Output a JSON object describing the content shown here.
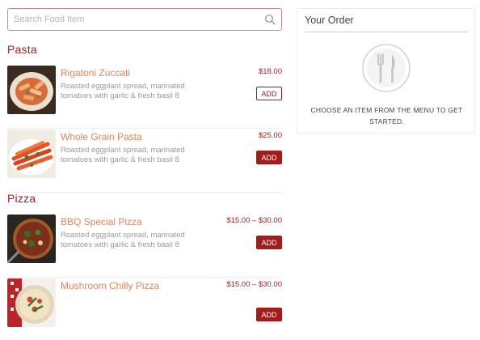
{
  "search": {
    "placeholder": "Search Food Item"
  },
  "sections": [
    {
      "title": "Pasta",
      "items": [
        {
          "name": "Rigatoni Zuccati",
          "description": "Roasted eggplant spread, marinated tomatoes with garlic & fresh basil 8",
          "price": "$18.00",
          "add_label": "ADD",
          "add_style": "outline"
        },
        {
          "name": "Whole Grain Pasta",
          "description": "Roasted eggplant spread, marinated tomatoes with garlic & fresh basil 8",
          "price": "$25.00",
          "add_label": "ADD",
          "add_style": "filled"
        }
      ]
    },
    {
      "title": "Pizza",
      "items": [
        {
          "name": "BBQ Special Pizza",
          "description": "Roasted eggplant spread, marinated tomatoes with garlic & fresh basil 8",
          "price": "$15.00 – $30.00",
          "add_label": "ADD",
          "add_style": "filled"
        },
        {
          "name": "Mushroom Chilly Pizza",
          "description": "",
          "price": "$15.00 – $30.00",
          "add_label": "ADD",
          "add_style": "filled"
        }
      ]
    }
  ],
  "order": {
    "title": "Your Order",
    "empty_message": "CHOOSE AN ITEM FROM THE MENU TO GET STARTED.",
    "icon": "fork-knife-icon"
  },
  "colors": {
    "brand_red": "#a31b1b",
    "item_name": "#e2845a",
    "price": "#9a1d1d"
  }
}
